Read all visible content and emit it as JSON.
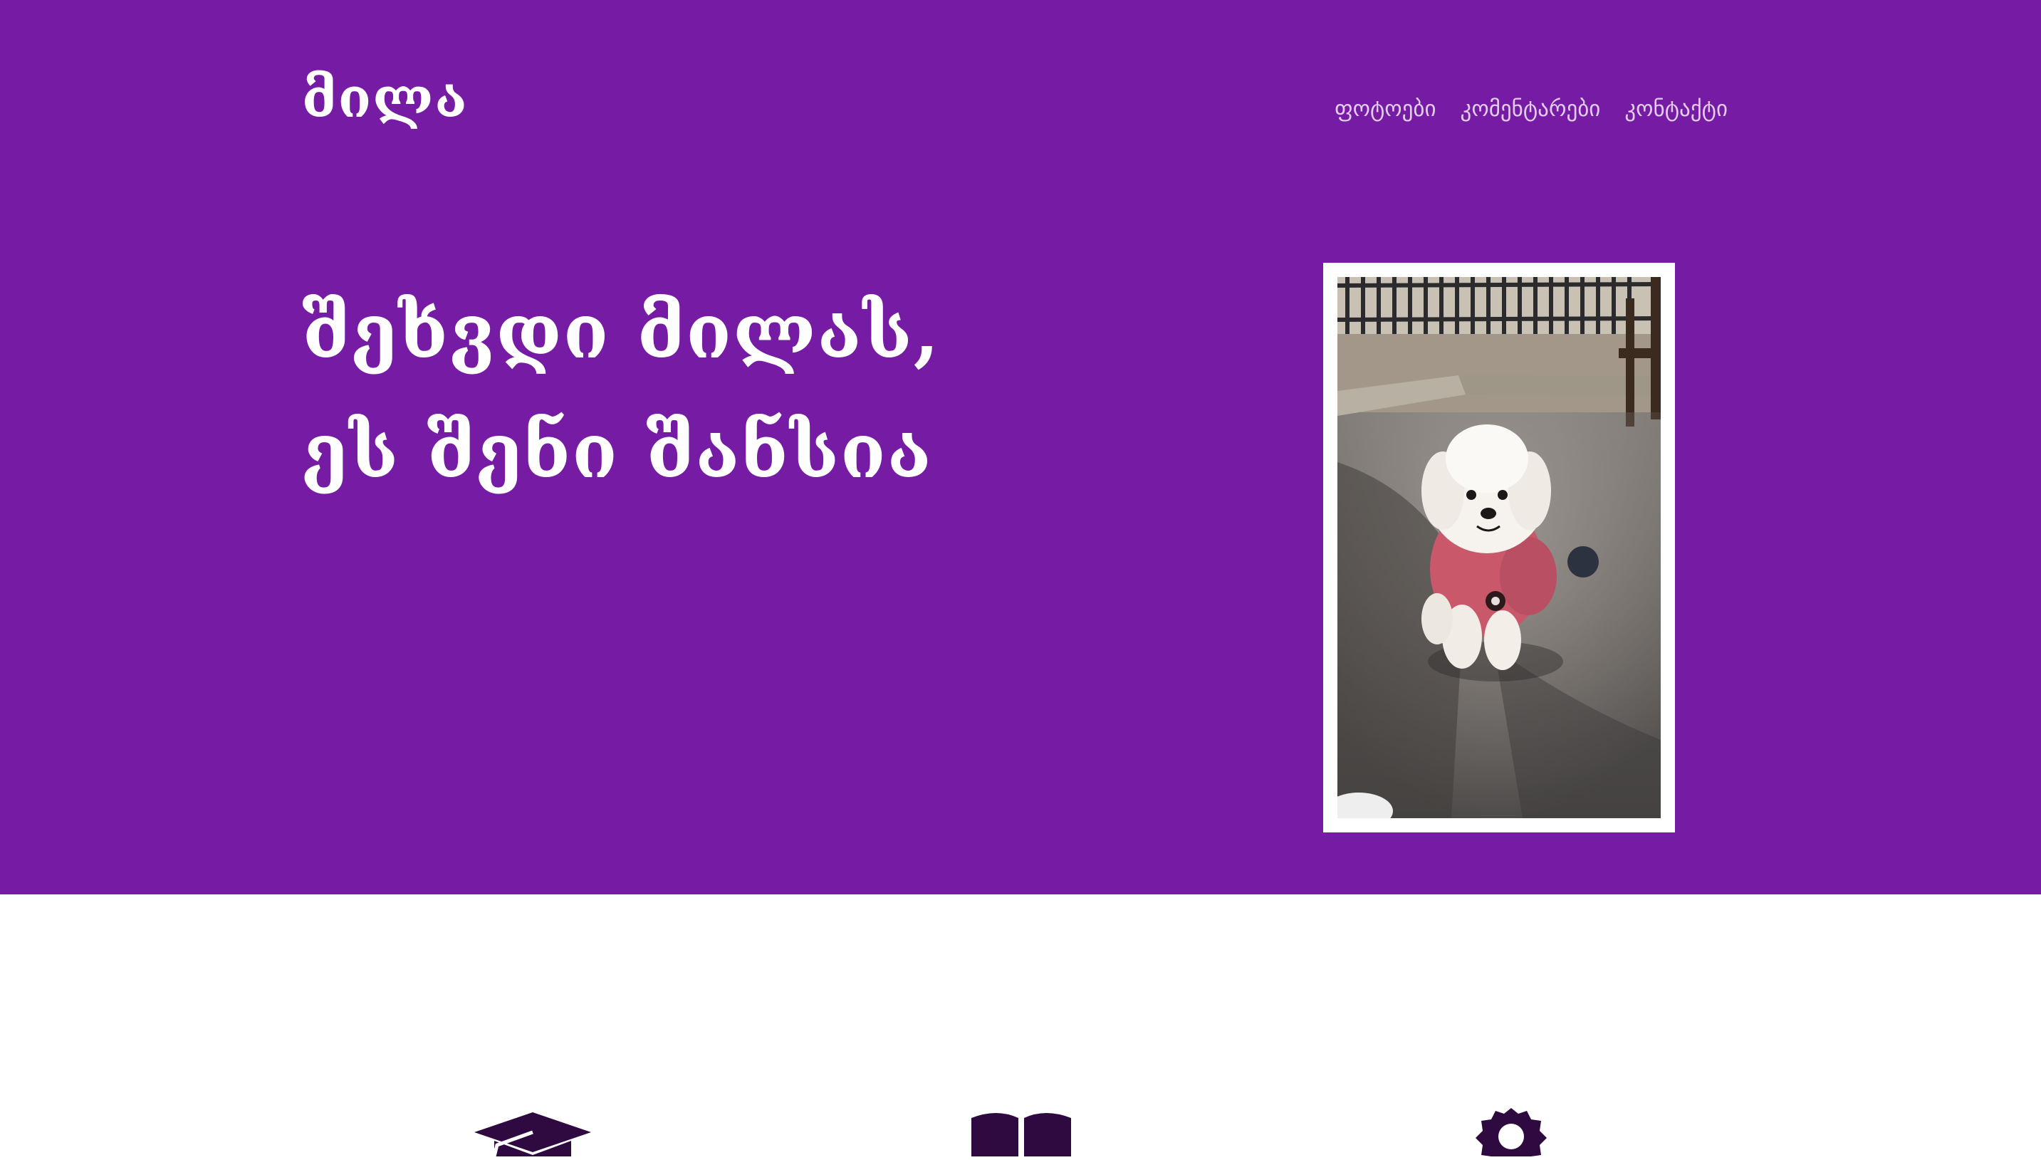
{
  "header": {
    "logo_text": "მილა",
    "nav": [
      {
        "label": "ფოტოები"
      },
      {
        "label": "კომენტარები"
      },
      {
        "label": "კონტაქტი"
      }
    ]
  },
  "hero": {
    "title_line1": "შეხვდი მილას,",
    "title_line2": "ეს შენი შანსია",
    "photo_subject": "white-dog-in-pink-hoodie"
  },
  "features": {
    "icons": [
      "graduation-cap-icon",
      "open-book-icon",
      "award-badge-icon"
    ]
  },
  "colors": {
    "brand_purple": "#761ca4",
    "nav_text": "#e3cdef",
    "icon_dark": "#2e0a40",
    "background": "#ffffff"
  }
}
